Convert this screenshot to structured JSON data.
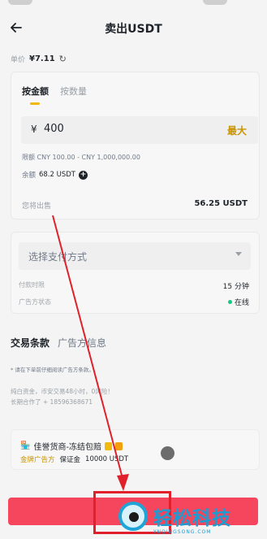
{
  "header": {
    "title": "卖出USDT",
    "back_icon": "arrow-left-icon"
  },
  "price": {
    "label": "单价",
    "value": "¥7.11",
    "refresh_icon": "refresh-icon"
  },
  "order_card": {
    "tabs": [
      {
        "label": "按金额",
        "active": true
      },
      {
        "label": "按数量",
        "active": false
      }
    ],
    "amount_input": {
      "currency": "¥",
      "value": "400",
      "max_label": "最大"
    },
    "limit_label": "限额",
    "limit_value": "CNY 100.00 - CNY 1,000,000.00",
    "balance_label": "余额",
    "balance_value": "68.2 USDT",
    "receive_label": "您将出售",
    "receive_value": "56.25 USDT"
  },
  "payment_card": {
    "select_placeholder": "选择支付方式",
    "time_label": "付款时限",
    "time_value": "15 分钟",
    "status_label": "广告方状态",
    "status_value": "在线",
    "status_color": "#0ecb81"
  },
  "section_tabs": [
    {
      "label": "交易条款",
      "active": true
    },
    {
      "label": "广告方信息",
      "active": false
    }
  ],
  "terms": {
    "notice": "* 请在下单前仔细阅读广告方条款。",
    "line1": "纯白资金，币安交易48小时，0风险！",
    "line2": "长期合作了 + 18596368671"
  },
  "advertiser": {
    "name": "佳誉货商-冻结包赔",
    "tag_label": "金牌广告方",
    "deposit_label": "保证金",
    "deposit_value": "10000 USDT"
  },
  "sell_button": {
    "label": "",
    "color": "#f6465d"
  },
  "watermark": {
    "text": "轻松科技",
    "sub": "YNQINGSONG.COM"
  }
}
